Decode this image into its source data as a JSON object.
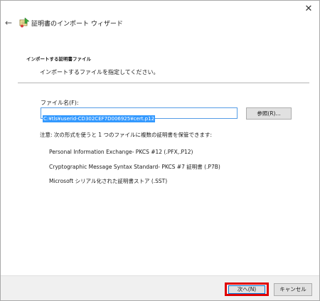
{
  "window": {
    "title": "証明書のインポート ウィザード",
    "close_glyph": "✕",
    "back_glyph": "←"
  },
  "section": {
    "title": "インポートする証明書ファイル",
    "description": "インポートするファイルを指定してください。"
  },
  "file": {
    "label": "ファイル名(F):",
    "value": "C:¥tls¥userid-CD302CEF7D006925¥cert.p12"
  },
  "buttons": {
    "browse": "参照(R)...",
    "next": "次へ(N)",
    "cancel": "キャンセル"
  },
  "formats": {
    "heading": "注意: 次の形式を使うと 1 つのファイルに複数の証明書を保管できます:",
    "items": [
      "Personal Information Exchange- PKCS #12 (.PFX,.P12)",
      "Cryptographic Message Syntax Standard- PKCS #7 証明書 (.P7B)",
      "Microsoft シリアル化された証明書ストア (.SST)"
    ]
  },
  "colors": {
    "accent": "#0078d7",
    "selection": "#3399ff",
    "highlight": "#e00000"
  },
  "icons": {
    "wizard": "certificate-wizard-icon",
    "back": "back-arrow-icon",
    "close": "close-icon"
  }
}
